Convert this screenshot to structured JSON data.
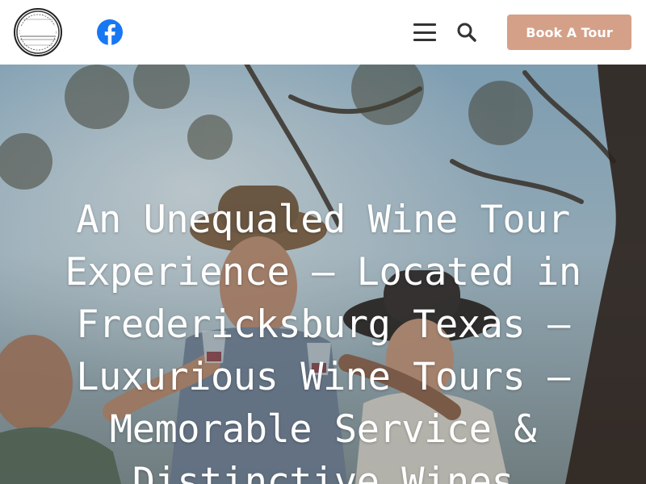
{
  "header": {
    "logo": {
      "text_line1": "About Town",
      "text_line2": "Wine Experiences",
      "icon": "about-town-logo-icon"
    },
    "facebook": {
      "icon": "facebook-icon",
      "color": "#1877f2"
    },
    "menu": {
      "icon": "hamburger-menu-icon"
    },
    "search": {
      "icon": "search-icon"
    },
    "book_button": {
      "label": "Book A Tour",
      "color": "#d4a088"
    }
  },
  "hero": {
    "title": "An Unequaled Wine Tour Experience – Located in Fredericksburg Texas – Luxurious Wine Tours – Memorable Service & Distinctive Wines"
  }
}
